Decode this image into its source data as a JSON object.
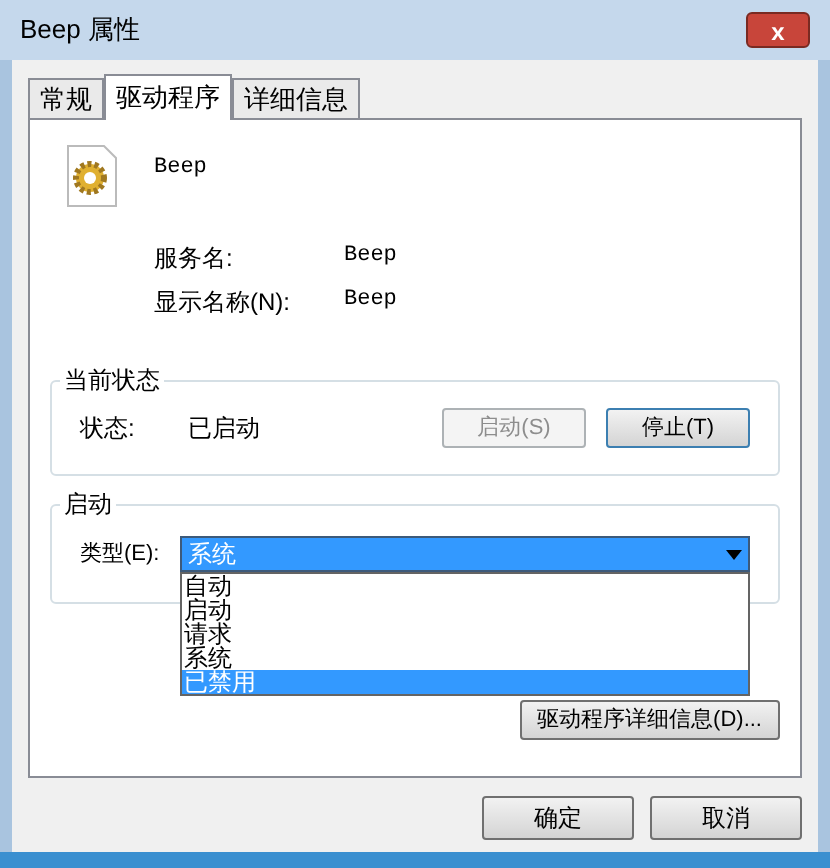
{
  "window": {
    "title": "Beep 属性",
    "close": "x"
  },
  "tabs": [
    {
      "label": "常规",
      "selected": false
    },
    {
      "label": "驱动程序",
      "selected": true
    },
    {
      "label": "详细信息",
      "selected": false
    }
  ],
  "service": {
    "name": "Beep",
    "fields": [
      {
        "label": "服务名:",
        "value": "Beep"
      },
      {
        "label": "显示名称(N):",
        "value": "Beep"
      }
    ]
  },
  "status_group": {
    "title": "当前状态",
    "label": "状态:",
    "value": "已启动",
    "buttons": [
      {
        "label": "启动(S)",
        "disabled": true
      },
      {
        "label": "停止(T)",
        "disabled": false
      }
    ]
  },
  "startup_group": {
    "title": "启动",
    "label": "类型(E):",
    "value": "系统",
    "options": [
      {
        "label": "自动",
        "highlighted": false
      },
      {
        "label": "启动",
        "highlighted": false
      },
      {
        "label": "请求",
        "highlighted": false
      },
      {
        "label": "系统",
        "highlighted": false
      },
      {
        "label": "已禁用",
        "highlighted": true
      }
    ]
  },
  "details_button": "驱动程序详细信息(D)...",
  "buttons": [
    "确定",
    "取消"
  ]
}
